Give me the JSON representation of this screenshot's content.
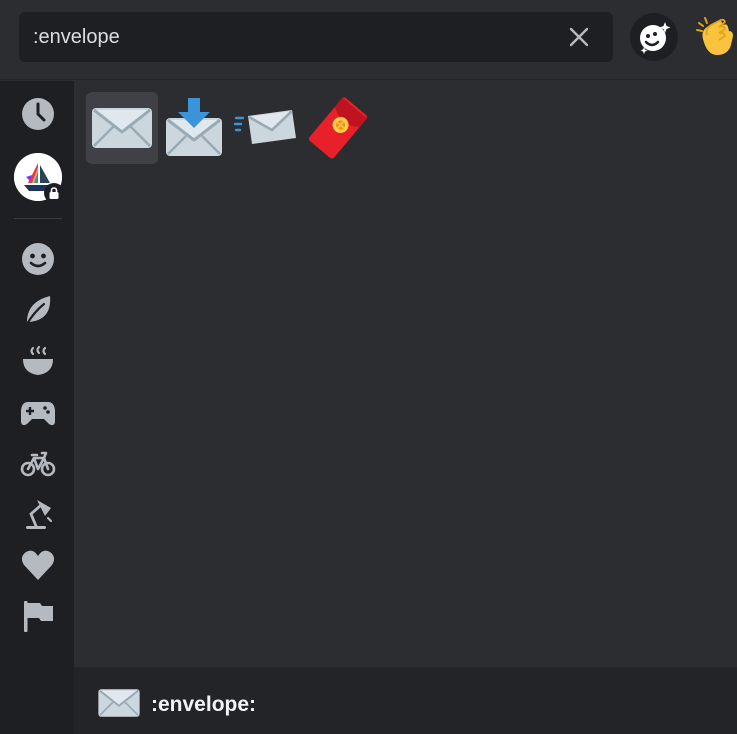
{
  "search": {
    "value": ":envelope"
  },
  "header": {
    "diversity_icon": "diversity-icon",
    "skin_tone_icon": "clapping-hands"
  },
  "rail": {
    "items": [
      {
        "icon": "clock-icon"
      },
      {
        "icon": "server-avatar",
        "badge": "lock-icon"
      },
      {
        "icon": "smiley-icon"
      },
      {
        "icon": "leaf-icon"
      },
      {
        "icon": "food-bowl-icon"
      },
      {
        "icon": "gamepad-icon"
      },
      {
        "icon": "bicycle-icon"
      },
      {
        "icon": "lamp-icon"
      },
      {
        "icon": "heart-icon"
      },
      {
        "icon": "flag-icon"
      }
    ]
  },
  "results": [
    {
      "icon": "envelope",
      "selected": true
    },
    {
      "icon": "envelope-with-arrow"
    },
    {
      "icon": "incoming-envelope"
    },
    {
      "icon": "red-envelope"
    }
  ],
  "inspector": {
    "name": ":envelope:",
    "icon": "envelope"
  },
  "colors": {
    "background": "#2b2d31",
    "rail": "#1e1f22",
    "footer": "#232428",
    "icon_gray": "#b5bac1",
    "selected": "#3f4147",
    "red_envelope": "#e8202a"
  }
}
